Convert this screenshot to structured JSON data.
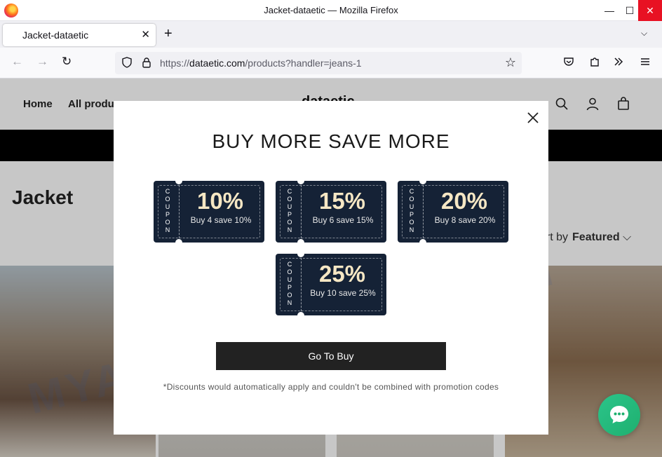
{
  "window": {
    "title": "Jacket-dataetic — Mozilla Firefox",
    "minimize_glyph": "—",
    "maximize_glyph": "☐",
    "close_glyph": "✕"
  },
  "tabs": [
    {
      "label": "Jacket-dataetic",
      "close_glyph": "✕"
    }
  ],
  "tabstrip": {
    "new_tab_glyph": "+",
    "list_glyph": "⌵"
  },
  "navbar": {
    "back_glyph": "←",
    "forward_glyph": "→",
    "reload_glyph": "↻",
    "url_scheme": "https://",
    "url_host": "dataetic.com",
    "url_path": "/products?handler=jeans-1",
    "bookmark_glyph": "☆",
    "icons": [
      "shield-icon",
      "lock-icon",
      "pocket-icon",
      "extensions-icon",
      "more-tools-icon",
      "hamburger-menu-icon"
    ]
  },
  "site": {
    "nav": {
      "home": "Home",
      "all_products": "All produ"
    },
    "logo": "dataetic",
    "collection_title": "Jacket",
    "sort_label": "ort by",
    "sort_value": "Featured",
    "sort_glyph": "⌵"
  },
  "modal": {
    "heading": "BUY MORE SAVE MORE",
    "close_glyph": "✕",
    "coupons": [
      {
        "label": "COUPON",
        "percent": "10%",
        "description": "Buy 4 save 10%"
      },
      {
        "label": "COUPON",
        "percent": "15%",
        "description": "Buy 6 save 15%"
      },
      {
        "label": "COUPON",
        "percent": "20%",
        "description": "Buy 8 save 20%"
      },
      {
        "label": "COUPON",
        "percent": "25%",
        "description": "Buy 10 save 25%"
      }
    ],
    "button_label": "Go To Buy",
    "disclaimer": "*Discounts would automatically apply and couldn't be combined with promotion codes"
  },
  "watermark": "MYANTISPYWARE.COM",
  "colors": {
    "coupon_bg": "#152236",
    "coupon_percent": "#f6e7c4",
    "button_bg": "#222222",
    "chat_bg": "#1fb06f",
    "close_button_bg": "#e81123"
  }
}
